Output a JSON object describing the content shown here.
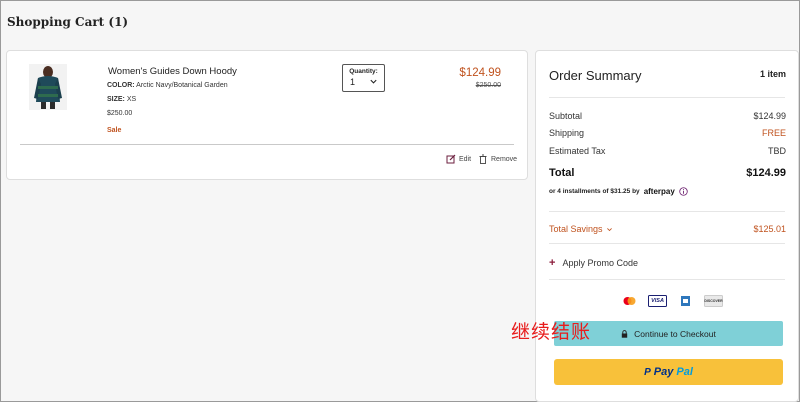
{
  "page": {
    "title": "Shopping Cart (1)"
  },
  "cart": {
    "item": {
      "name": "Women's Guides Down Hoody",
      "color_label": "COLOR:",
      "color_value": "Arctic Navy/Botanical Garden",
      "size_label": "SIZE:",
      "size_value": "XS",
      "original_price_line": "$250.00",
      "sale_tag": "Sale",
      "quantity_label": "Quantity:",
      "quantity_value": "1",
      "price_sale": "$124.99",
      "price_original": "$250.00",
      "edit_label": "Edit",
      "remove_label": "Remove"
    }
  },
  "summary": {
    "title": "Order Summary",
    "item_count": "1 item",
    "subtotal_label": "Subtotal",
    "subtotal_value": "$124.99",
    "shipping_label": "Shipping",
    "shipping_value": "FREE",
    "tax_label": "Estimated Tax",
    "tax_value": "TBD",
    "total_label": "Total",
    "total_value": "$124.99",
    "installments_text": "or 4 installments of $31.25 by",
    "afterpay_logo": "afterpay",
    "savings_label": "Total Savings",
    "savings_value": "$125.01",
    "promo_label": "Apply Promo Code",
    "payment_cards": [
      "mastercard",
      "visa",
      "amex",
      "discover"
    ],
    "discover_text": "DISCOVER",
    "visa_text": "VISA",
    "checkout_label": "Continue to Checkout",
    "paypal_mark": "P",
    "paypal_pay": "Pay",
    "paypal_pal": "Pal"
  },
  "overlay": {
    "text": "继续结账"
  },
  "colors": {
    "accent_sale": "#c0531f",
    "checkout_button": "#7fd0d7",
    "paypal_button": "#f8c13a",
    "overlay_text": "#e81c1c"
  },
  "icons": [
    "hoody-product-image",
    "chevron-down-icon",
    "edit-icon",
    "trash-icon",
    "info-icon",
    "lock-icon"
  ]
}
